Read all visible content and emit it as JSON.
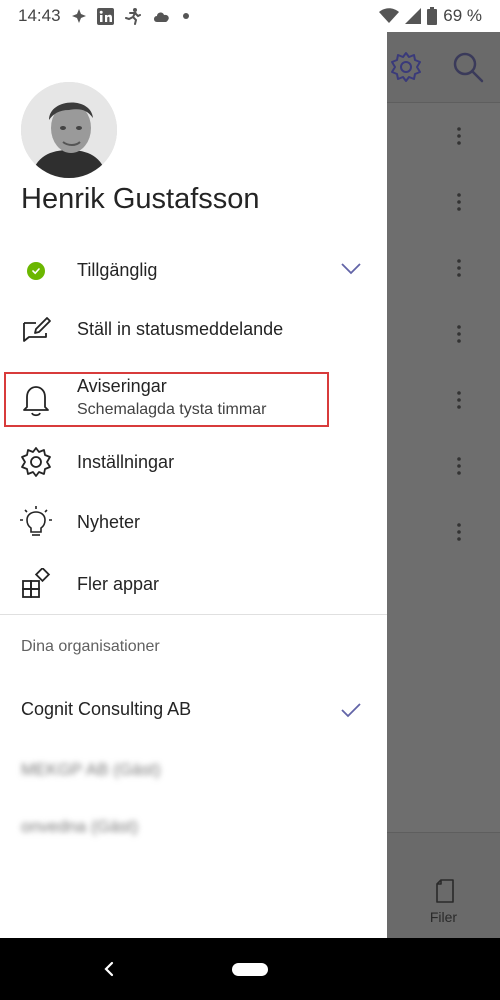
{
  "status_bar": {
    "time": "14:43",
    "battery_percent": "69 %",
    "icons": [
      "app-notification-icon",
      "linkedin-icon",
      "activity-icon",
      "cloud-icon",
      "dot-icon",
      "wifi-icon",
      "signal-icon",
      "battery-icon"
    ]
  },
  "profile": {
    "name": "Henrik Gustafsson"
  },
  "menu": {
    "status": {
      "label": "Tillgänglig",
      "color": "#6bb700"
    },
    "status_message": {
      "label": "Ställ in statusmeddelande"
    },
    "notifications": {
      "label": "Aviseringar",
      "sublabel": "Schemalagda tysta timmar"
    },
    "settings": {
      "label": "Inställningar"
    },
    "news": {
      "label": "Nyheter"
    },
    "more_apps": {
      "label": "Fler appar"
    }
  },
  "organizations": {
    "title": "Dina organisationer",
    "current": "Cognit Consulting AB",
    "blurred_1": "MEKGP AB (Gäst)",
    "blurred_2": "onvedna (Gäst)"
  },
  "background_app": {
    "files_label": "Filer"
  },
  "colors": {
    "accent": "#6264a7",
    "highlight_border": "#d83b3b",
    "status_available": "#6bb700"
  }
}
